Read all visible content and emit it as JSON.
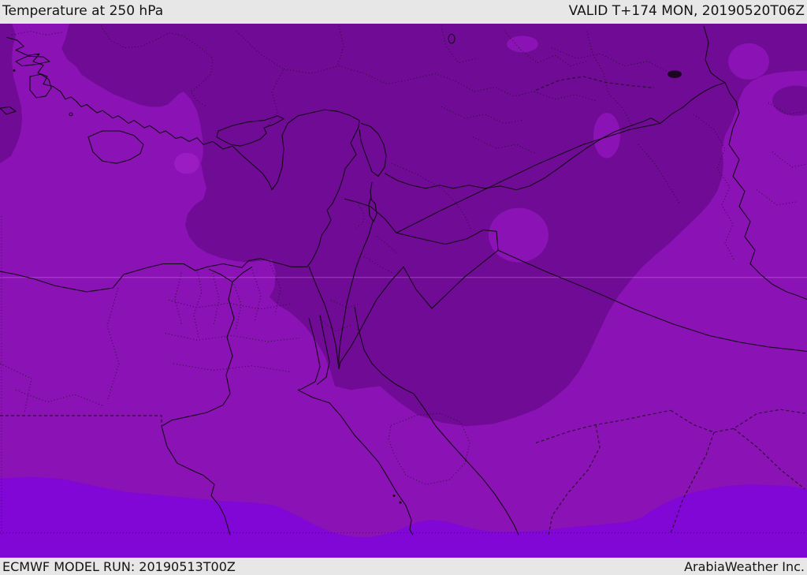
{
  "colors": {
    "medium": "#8B12B4",
    "dark": "#6F0B94",
    "bright": "#8007D6",
    "light": "#9B1CC2",
    "bar_bg": "#E7E7E7",
    "bar_text": "#141414",
    "border_line": "#140617",
    "admin_line": "#2E0B35",
    "gridline": "#C98FE2"
  },
  "header": {
    "title": "Temperature at 250 hPa",
    "valid_time": "VALID T+174 MON, 20190520T06Z"
  },
  "footer": {
    "model_run": "ECMWF MODEL RUN: 20190513T00Z",
    "credit": "ArabiaWeather Inc."
  }
}
